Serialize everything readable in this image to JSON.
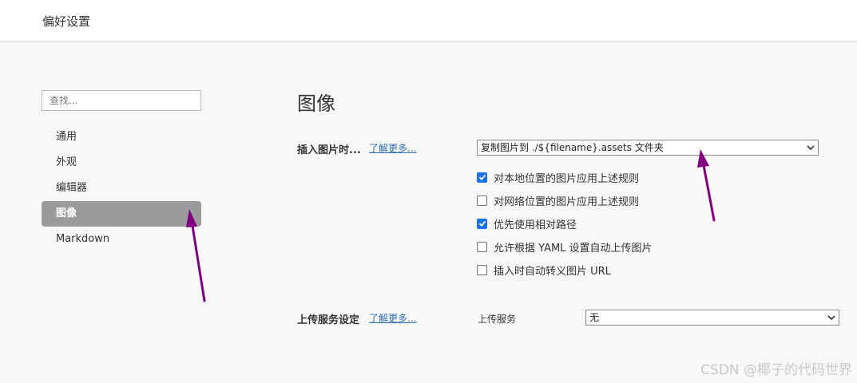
{
  "window": {
    "title": "偏好设置"
  },
  "sidebar": {
    "search_placeholder": "查找...",
    "items": [
      {
        "label": "通用",
        "active": false
      },
      {
        "label": "外观",
        "active": false
      },
      {
        "label": "编辑器",
        "active": false
      },
      {
        "label": "图像",
        "active": true
      },
      {
        "label": "Markdown",
        "active": false
      }
    ]
  },
  "main": {
    "title": "图像",
    "insert": {
      "label": "插入图片时...",
      "learn_more": "了解更多...",
      "select_value": "复制图片到 ./${filename}.assets 文件夹",
      "options": [
        {
          "label": "对本地位置的图片应用上述规则",
          "checked": true
        },
        {
          "label": "对网络位置的图片应用上述规则",
          "checked": false
        },
        {
          "label": "优先使用相对路径",
          "checked": true
        },
        {
          "label": "允许根据 YAML 设置自动上传图片",
          "checked": false
        },
        {
          "label": "插入时自动转义图片 URL",
          "checked": false
        }
      ]
    },
    "upload": {
      "label": "上传服务设定",
      "learn_more": "了解更多...",
      "service_label": "上传服务",
      "service_value": "无"
    }
  },
  "annotations": {
    "arrow_color": "#800080"
  },
  "colors": {
    "checkbox_checked": "#1a73e8",
    "nav_active_bg": "#9b9b9b",
    "link": "#2e6fb3"
  },
  "watermark": "CSDN @椰子的代码世界"
}
